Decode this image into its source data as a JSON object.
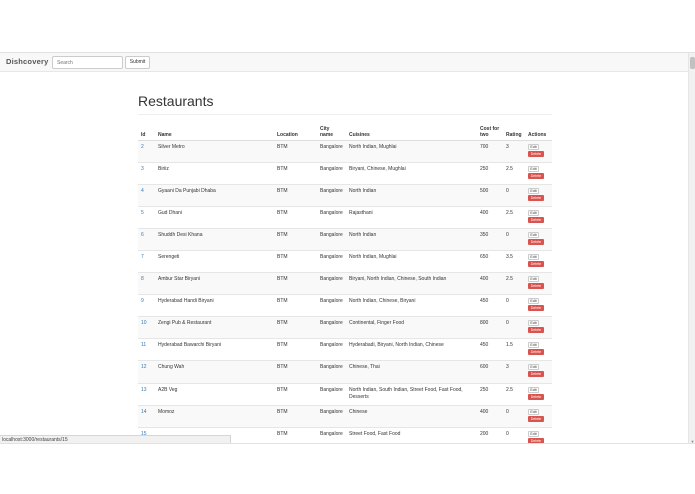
{
  "nav": {
    "brand": "Dishcovery",
    "search_placeholder": "Search",
    "submit_label": "Submit"
  },
  "page_title": "Restaurants",
  "table": {
    "headers": [
      "Id",
      "Name",
      "Location",
      "City name",
      "Cuisines",
      "Cost for two",
      "Rating",
      "Actions"
    ],
    "rows": [
      {
        "id": "2",
        "name": "Silver Metro",
        "location": "BTM",
        "city": "Bangalore",
        "cuisines": "North Indian, Mughlai",
        "cost": "700",
        "rating": "3"
      },
      {
        "id": "3",
        "name": "Biriiz",
        "location": "BTM",
        "city": "Bangalore",
        "cuisines": "Biryani, Chinese, Mughlai",
        "cost": "250",
        "rating": "2.5"
      },
      {
        "id": "4",
        "name": "Gyaani Da Punjabi Dhaba",
        "location": "BTM",
        "city": "Bangalore",
        "cuisines": "North Indian",
        "cost": "500",
        "rating": "0"
      },
      {
        "id": "5",
        "name": "Gud Dhani",
        "location": "BTM",
        "city": "Bangalore",
        "cuisines": "Rajasthani",
        "cost": "400",
        "rating": "2.5"
      },
      {
        "id": "6",
        "name": "Shuddh Desi Khana",
        "location": "BTM",
        "city": "Bangalore",
        "cuisines": "North Indian",
        "cost": "350",
        "rating": "0"
      },
      {
        "id": "7",
        "name": "Serengeti",
        "location": "BTM",
        "city": "Bangalore",
        "cuisines": "North Indian, Mughlai",
        "cost": "650",
        "rating": "3.5"
      },
      {
        "id": "8",
        "name": "Ambur Star Biryani",
        "location": "BTM",
        "city": "Bangalore",
        "cuisines": "Biryani, North Indian, Chinese, South Indian",
        "cost": "400",
        "rating": "2.5"
      },
      {
        "id": "9",
        "name": "Hyderabad Handi Biryani",
        "location": "BTM",
        "city": "Bangalore",
        "cuisines": "North Indian, Chinese, Biryani",
        "cost": "450",
        "rating": "0"
      },
      {
        "id": "10",
        "name": "Zengi Pub & Restaurant",
        "location": "BTM",
        "city": "Bangalore",
        "cuisines": "Continental, Finger Food",
        "cost": "800",
        "rating": "0"
      },
      {
        "id": "11",
        "name": "Hyderabad Bawarchi Biryani",
        "location": "BTM",
        "city": "Bangalore",
        "cuisines": "Hyderabadi, Biryani, North Indian, Chinese",
        "cost": "450",
        "rating": "1.5"
      },
      {
        "id": "12",
        "name": "Chung Wah",
        "location": "BTM",
        "city": "Bangalore",
        "cuisines": "Chinese, Thai",
        "cost": "600",
        "rating": "3"
      },
      {
        "id": "13",
        "name": "A2B Veg",
        "location": "BTM",
        "city": "Bangalore",
        "cuisines": "North Indian, South Indian, Street Food, Fast Food, Desserts",
        "cost": "250",
        "rating": "2.5"
      },
      {
        "id": "14",
        "name": "Momoz",
        "location": "BTM",
        "city": "Bangalore",
        "cuisines": "Chinese",
        "cost": "400",
        "rating": "0"
      },
      {
        "id": "15",
        "name": "",
        "location": "BTM",
        "city": "Bangalore",
        "cuisines": "Street Food, Fast Food",
        "cost": "200",
        "rating": "0"
      }
    ],
    "edit_label": "Edit",
    "delete_label": "Delete"
  },
  "status_bar": "localhost:3000/restaurants/15",
  "colors": {
    "link": "#337ab7",
    "delete": "#d9534f",
    "navbar_bg": "#f8f8f8"
  }
}
